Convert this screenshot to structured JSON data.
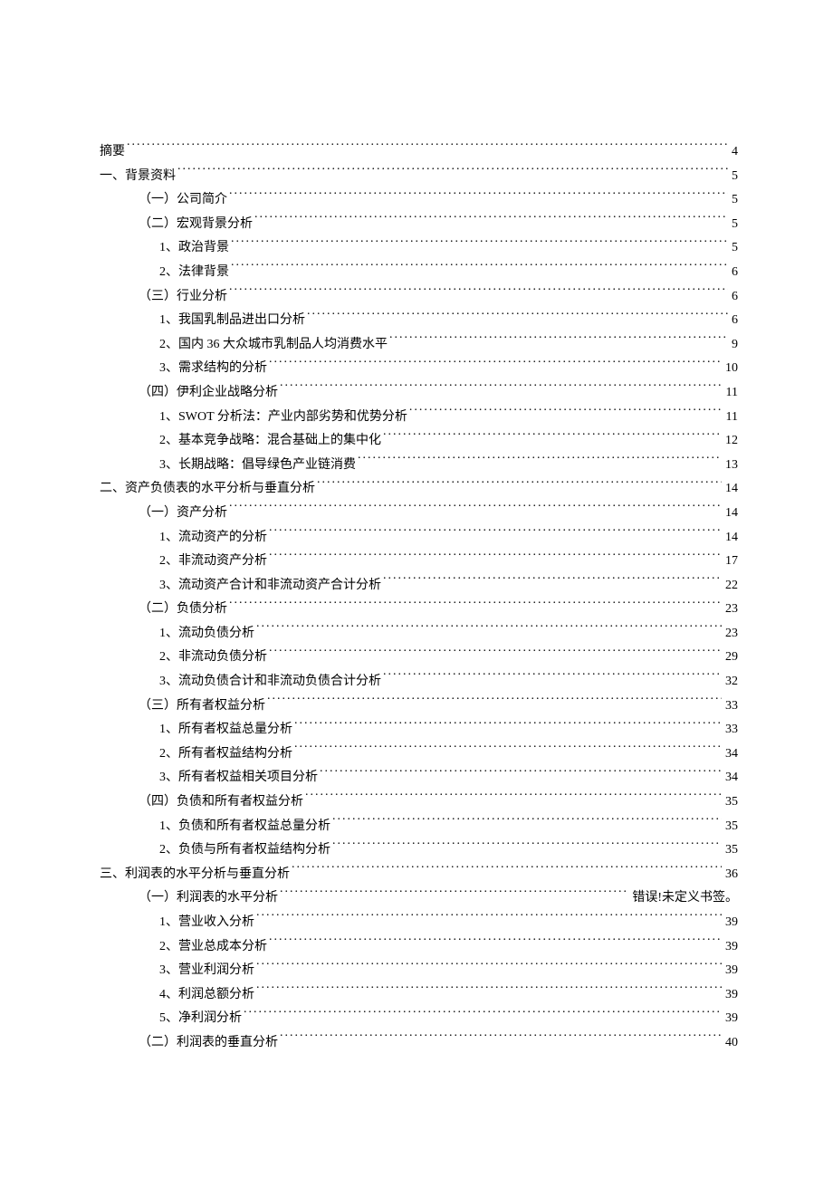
{
  "toc": [
    {
      "label": "摘要",
      "page": "4",
      "level": 0
    },
    {
      "label": "一、背景资料",
      "page": "5",
      "level": 0
    },
    {
      "label": "（一）公司简介",
      "page": "5",
      "level": 1
    },
    {
      "label": "（二）宏观背景分析",
      "page": "5",
      "level": 1
    },
    {
      "label": "1、政治背景",
      "page": "5",
      "level": 2
    },
    {
      "label": "2、法律背景",
      "page": "6",
      "level": 2
    },
    {
      "label": "（三）行业分析",
      "page": "6",
      "level": 1
    },
    {
      "label": "1、我国乳制品进出口分析",
      "page": "6",
      "level": 2
    },
    {
      "label": "2、国内 36 大众城市乳制品人均消费水平",
      "page": "9",
      "level": 2
    },
    {
      "label": "3、需求结构的分析",
      "page": "10",
      "level": 2
    },
    {
      "label": "（四）伊利企业战略分析",
      "page": "11",
      "level": 1
    },
    {
      "label": "1、SWOT 分析法：产业内部劣势和优势分析",
      "page": "11",
      "level": 2
    },
    {
      "label": "2、基本竞争战略：混合基础上的集中化",
      "page": "12",
      "level": 2
    },
    {
      "label": "3、长期战略：倡导绿色产业链消费",
      "page": "13",
      "level": 2
    },
    {
      "label": "二、资产负债表的水平分析与垂直分析",
      "page": "14",
      "level": 0
    },
    {
      "label": "（一）资产分析",
      "page": "14",
      "level": 1
    },
    {
      "label": "1、流动资产的分析",
      "page": "14",
      "level": 2
    },
    {
      "label": "2、非流动资产分析",
      "page": "17",
      "level": 2
    },
    {
      "label": "3、流动资产合计和非流动资产合计分析",
      "page": "22",
      "level": 2
    },
    {
      "label": "（二）负债分析",
      "page": "23",
      "level": 1
    },
    {
      "label": "1、流动负债分析",
      "page": "23",
      "level": 2
    },
    {
      "label": "2、非流动负债分析",
      "page": "29",
      "level": 2
    },
    {
      "label": "3、流动负债合计和非流动负债合计分析",
      "page": "32",
      "level": 2
    },
    {
      "label": "（三）所有者权益分析",
      "page": "33",
      "level": 1
    },
    {
      "label": "1、所有者权益总量分析",
      "page": "33",
      "level": 2
    },
    {
      "label": "2、所有者权益结构分析",
      "page": "34",
      "level": 2
    },
    {
      "label": "3、所有者权益相关项目分析",
      "page": "34",
      "level": 2
    },
    {
      "label": "（四）负债和所有者权益分析",
      "page": "35",
      "level": 1
    },
    {
      "label": "1、负债和所有者权益总量分析",
      "page": "35",
      "level": 2
    },
    {
      "label": "2、负债与所有者权益结构分析",
      "page": "35",
      "level": 2
    },
    {
      "label": "三、利润表的水平分析与垂直分析",
      "page": "36",
      "level": 0
    },
    {
      "label": "（一）利润表的水平分析",
      "page": "错误!未定义书签。",
      "level": 1,
      "noLeader": true
    },
    {
      "label": "1、营业收入分析",
      "page": "39",
      "level": 2
    },
    {
      "label": "2、营业总成本分析",
      "page": "39",
      "level": 2
    },
    {
      "label": "3、营业利润分析",
      "page": "39",
      "level": 2
    },
    {
      "label": "4、利润总额分析",
      "page": "39",
      "level": 2
    },
    {
      "label": "5、净利润分析",
      "page": "39",
      "level": 2
    },
    {
      "label": "（二）利润表的垂直分析",
      "page": "40",
      "level": 1
    }
  ]
}
